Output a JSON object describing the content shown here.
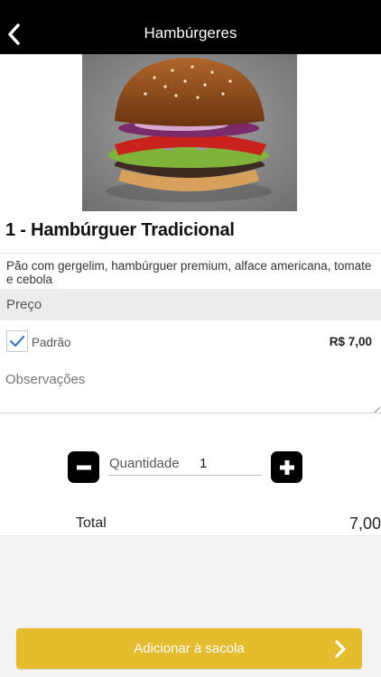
{
  "header": {
    "title": "Hambúrgeres",
    "back_icon": "chevron-left-icon"
  },
  "product": {
    "image": "hamburger-photo",
    "title": "1 - Hambúrguer Tradicional",
    "description": "Pão com gergelim, hambúrguer premium, alface americana, tomate e cebola"
  },
  "price_section": {
    "label": "Preço",
    "options": [
      {
        "label": "Padrão",
        "price": "R$ 7,00",
        "checked": true
      }
    ]
  },
  "notes": {
    "placeholder": "Observações",
    "value": ""
  },
  "quantity": {
    "label": "Quantidade",
    "value": "1",
    "minus_icon": "minus-icon",
    "plus_icon": "plus-icon"
  },
  "total": {
    "label": "Total",
    "value": "7,00"
  },
  "add_button": {
    "label": "Adicionar à sacola",
    "icon": "chevron-right-icon"
  },
  "colors": {
    "topbar": "#000000",
    "accent_button": "#e5bc2d",
    "check": "#3a78c8",
    "section_bg": "#ececec"
  }
}
